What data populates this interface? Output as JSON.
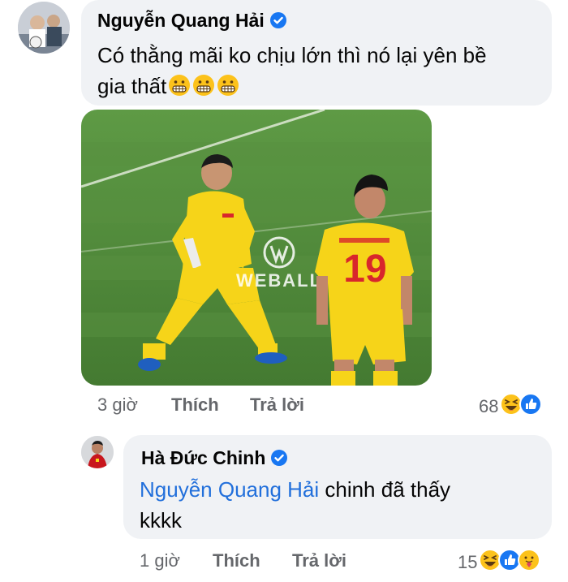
{
  "comment1": {
    "author": "Nguyễn Quang Hải",
    "text_line1": "Có thằng mãi ko chịu lớn thì nó lại yên bề",
    "text_line2": "gia thất",
    "emoji_icons": [
      "grimacing-face-icon",
      "grimacing-face-icon",
      "grimacing-face-icon"
    ],
    "photo": {
      "jersey_number": "19",
      "watermark": "WEBALL",
      "colors": {
        "pitch": "#4f8a3a",
        "kit": "#f6d419",
        "number": "#d8262c"
      }
    },
    "time": "3 giờ",
    "like_label": "Thích",
    "reply_label": "Trả lời",
    "reaction_count": "68",
    "reaction_icons": [
      "haha-icon",
      "like-icon"
    ]
  },
  "reply1": {
    "author": "Hà Đức Chinh",
    "mention": "Nguyễn Quang Hải",
    "text_after_mention": " chinh đã thấy",
    "text_line2": "kkkk",
    "time": "1 giờ",
    "like_label": "Thích",
    "reply_label": "Trả lời",
    "reaction_count": "15",
    "reaction_icons": [
      "haha-icon",
      "like-icon",
      "care-icon"
    ]
  },
  "colors": {
    "bubble": "#f0f2f5",
    "verified": "#1877f2",
    "mention": "#216fdb",
    "meta": "#65676b"
  }
}
